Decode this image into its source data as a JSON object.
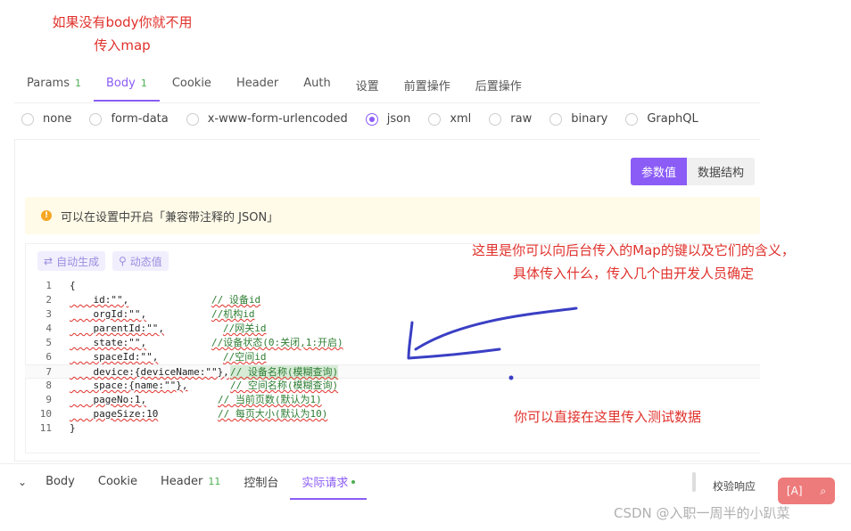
{
  "notes": {
    "top": "如果没有body你就不用传入map",
    "right": "这里是你可以向后台传入的Map的键以及它们的含义，具体传入什么，传入几个由开发人员确定",
    "bottom": "你可以直接在这里传入测试数据"
  },
  "tabs": [
    {
      "label": "Params",
      "count": "1"
    },
    {
      "label": "Body",
      "count": "1"
    },
    {
      "label": "Cookie",
      "count": ""
    },
    {
      "label": "Header",
      "count": ""
    },
    {
      "label": "Auth",
      "count": ""
    },
    {
      "label": "设置",
      "count": ""
    },
    {
      "label": "前置操作",
      "count": ""
    },
    {
      "label": "后置操作",
      "count": ""
    }
  ],
  "body_types": [
    "none",
    "form-data",
    "x-www-form-urlencoded",
    "json",
    "xml",
    "raw",
    "binary",
    "GraphQL"
  ],
  "selected_body_type": "json",
  "view_toggle": {
    "params": "参数值",
    "schema": "数据结构"
  },
  "tip": "可以在设置中开启「兼容带注释的 JSON」",
  "editor_buttons": {
    "auto": "自动生成",
    "dynamic": "动态值"
  },
  "code_lines": [
    {
      "n": "1",
      "code": "{",
      "comment": ""
    },
    {
      "n": "2",
      "code": "    id:\"\",",
      "comment": "// 设备id"
    },
    {
      "n": "3",
      "code": "    orgId:\"\",",
      "comment": "//机构id"
    },
    {
      "n": "4",
      "code": "    parentId:\"\",",
      "comment": "//网关id"
    },
    {
      "n": "5",
      "code": "    state:\"\",",
      "comment": "//设备状态(0:关闭,1:开启)"
    },
    {
      "n": "6",
      "code": "    spaceId:\"\",",
      "comment": "//空间id"
    },
    {
      "n": "7",
      "code": "    device:{deviceName:\"\"},",
      "comment": "// 设备名称(模糊查询)"
    },
    {
      "n": "8",
      "code": "    space:{name:\"\"},",
      "comment": "// 空间名称(模糊查询)"
    },
    {
      "n": "9",
      "code": "    pageNo:1,",
      "comment": "// 当前页数(默认为1)"
    },
    {
      "n": "10",
      "code": "    pageSize:10",
      "comment": "// 每页大小(默认为10)"
    },
    {
      "n": "11",
      "code": "}",
      "comment": ""
    }
  ],
  "bottom_tabs": [
    {
      "label": "Body",
      "count": ""
    },
    {
      "label": "Cookie",
      "count": ""
    },
    {
      "label": "Header",
      "count": "11"
    },
    {
      "label": "控制台",
      "count": ""
    },
    {
      "label": "实际请求",
      "count": ""
    }
  ],
  "verify_label": "校验响应",
  "watermark": "CSDN @入职一周半的小趴菜",
  "colors": {
    "accent": "#8b5cf6",
    "annotation": "#e0312b",
    "arrow": "#3a3fc4"
  }
}
